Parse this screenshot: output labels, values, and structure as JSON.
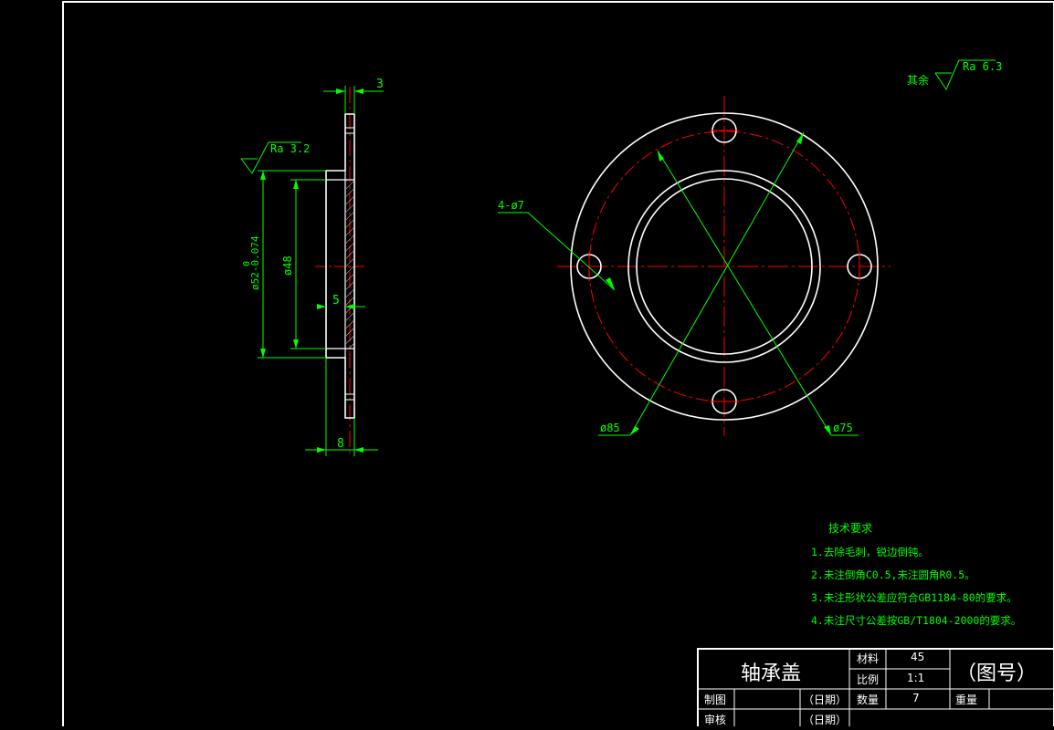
{
  "drawing": {
    "side_view": {
      "ra_label": "Ra 3.2",
      "dim_top": "3",
      "dim_outer": "ø52-0.074",
      "dim_outer_upper": "0",
      "dim_inner": "ø48",
      "dim_step": "5",
      "dim_bottom": "8"
    },
    "front_view": {
      "holes_label": "4-ø7",
      "dim_outer": "ø85",
      "dim_pcd": "ø75"
    },
    "surface_note": {
      "label": "其余",
      "ra": "Ra 6.3"
    },
    "tech_requirements": {
      "title": "技术要求",
      "items": [
        "1.去除毛刺，锐边倒钝。",
        "2.未注倒角C0.5,未注圆角R0.5。",
        "3.未注形状公差应符合GB1184-80的要求。",
        "4.未注尺寸公差按GB/T1804-2000的要求。"
      ]
    }
  },
  "title_block": {
    "part_name": "轴承盖",
    "material_label": "材料",
    "material_value": "45",
    "scale_label": "比例",
    "scale_value": "1:1",
    "quantity_label": "数量",
    "quantity_value": "7",
    "weight_label": "重量",
    "drawing_no": "（图号）",
    "drawn_label": "制图",
    "date_label_1": "（日期）",
    "checked_label": "审核",
    "date_label_2": "（日期）"
  },
  "colors": {
    "background": "#000000",
    "outline": "#ffffff",
    "dimension": "#00ff00",
    "centerline": "#ff0000"
  }
}
